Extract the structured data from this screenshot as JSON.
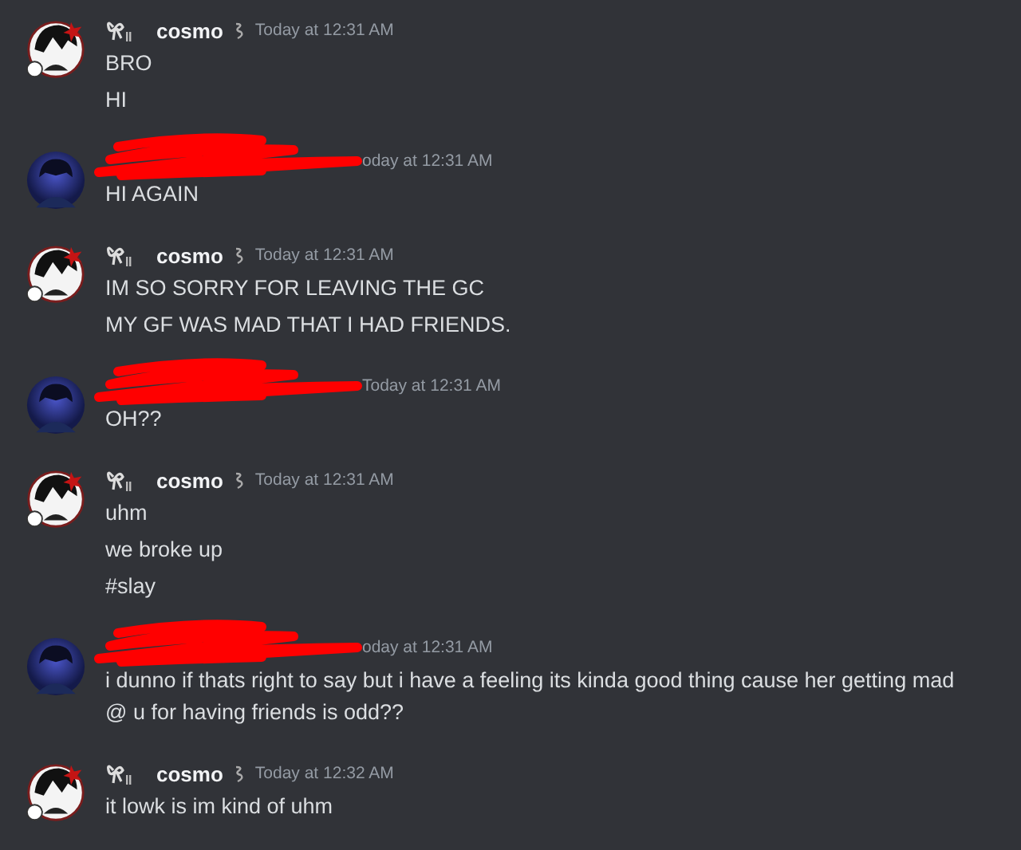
{
  "messages": [
    {
      "kind": "cosmo",
      "author": "cosmo",
      "time": "Today at 12:31 AM",
      "lines": [
        "BRO",
        "HI"
      ]
    },
    {
      "kind": "redacted",
      "time": "oday at 12:31 AM",
      "lines": [
        "HI AGAIN"
      ]
    },
    {
      "kind": "cosmo",
      "author": "cosmo",
      "time": "Today at 12:31 AM",
      "lines": [
        "IM SO SORRY FOR LEAVING THE GC",
        "MY GF WAS MAD THAT I HAD FRIENDS."
      ]
    },
    {
      "kind": "redacted",
      "time": "Today at 12:31 AM",
      "lines": [
        "OH??"
      ]
    },
    {
      "kind": "cosmo",
      "author": "cosmo",
      "time": "Today at 12:31 AM",
      "lines": [
        "uhm",
        "we broke up",
        "#slay"
      ]
    },
    {
      "kind": "redacted",
      "time": "oday at 12:31 AM",
      "lines": [
        "i dunno if thats right to say but i have a feeling its kinda good thing cause her getting mad @ u for having friends is odd??"
      ]
    },
    {
      "kind": "cosmo",
      "author": "cosmo",
      "time": "Today at 12:32 AM",
      "lines": [
        "it lowk is im kind of uhm"
      ]
    }
  ]
}
